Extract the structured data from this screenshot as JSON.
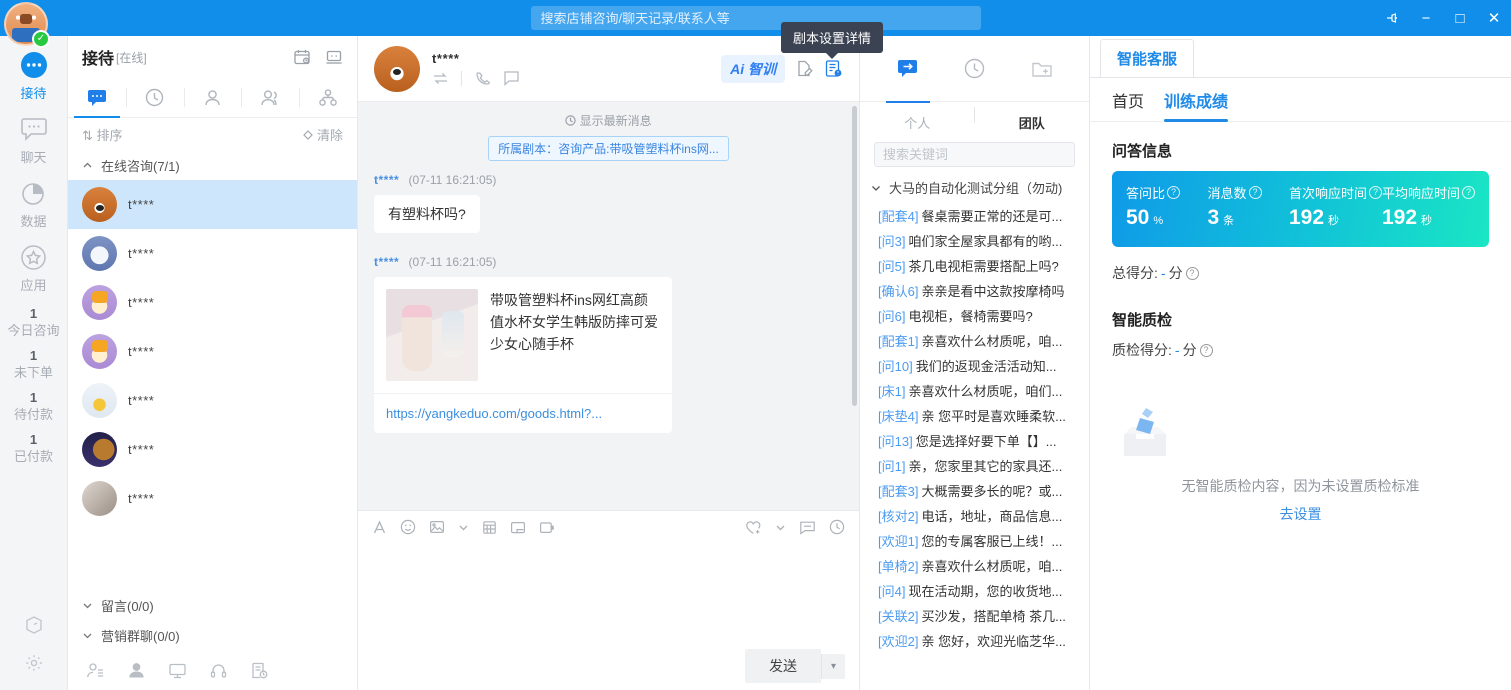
{
  "titlebar": {
    "search_placeholder": "搜索店铺咨询/聊天记录/联系人等",
    "pin_icon": "pin-icon",
    "minimize_label": "−",
    "maximize_label": "□",
    "close_label": "✕",
    "online_check": "✓"
  },
  "tooltip": {
    "text": "剧本设置详情"
  },
  "rail": {
    "items": [
      {
        "label": "接待",
        "icon": "reception-dots-icon",
        "active": true
      },
      {
        "label": "聊天",
        "icon": "chat-bubble-icon",
        "active": false
      },
      {
        "label": "数据",
        "icon": "pie-chart-icon",
        "active": false
      },
      {
        "label": "应用",
        "icon": "star-circle-icon",
        "active": false
      }
    ],
    "stats": [
      {
        "num": "1",
        "label": "今日咨询"
      },
      {
        "num": "1",
        "label": "未下单"
      },
      {
        "num": "1",
        "label": "待付款"
      },
      {
        "num": "1",
        "label": "已付款"
      }
    ],
    "bottom_icons": [
      "box-icon",
      "gear-icon"
    ]
  },
  "contacts": {
    "title": "接待",
    "status": "[在线]",
    "head_icons": [
      "calendar-settings-icon",
      "monitor-chat-icon"
    ],
    "tabs": [
      {
        "icon": "message-icon",
        "active": true
      },
      {
        "icon": "clock-icon",
        "active": false
      },
      {
        "icon": "person-icon",
        "active": false
      },
      {
        "icon": "people-icon",
        "active": false
      },
      {
        "icon": "org-tree-icon",
        "active": false
      }
    ],
    "sort_label": "排序",
    "clear_label": "清除",
    "group_label": "在线咨询(7/1)",
    "rows": [
      {
        "name": "t****",
        "avatar": "a-dog",
        "selected": true
      },
      {
        "name": "t****",
        "avatar": "a-bear",
        "selected": false
      },
      {
        "name": "t****",
        "avatar": "a-giraffe",
        "selected": false
      },
      {
        "name": "t****",
        "avatar": "a-giraffe",
        "selected": false
      },
      {
        "name": "t****",
        "avatar": "a-dress",
        "selected": false
      },
      {
        "name": "t****",
        "avatar": "a-bird",
        "selected": false
      },
      {
        "name": "t****",
        "avatar": "a-photo",
        "selected": false
      }
    ],
    "footer_groups": [
      {
        "label": "留言(0/0)"
      },
      {
        "label": "营销群聊(0/0)"
      }
    ],
    "footer_icons": [
      "contact-list-icon",
      "customer-icon",
      "monitor-icon",
      "headset-icon",
      "order-history-icon"
    ]
  },
  "chat": {
    "contact_name": "t****",
    "header_icons": [
      "transfer-icon",
      "phone-icon",
      "comment-icon"
    ],
    "ai_button": "Ai 智训",
    "right_icons": [
      "note-edit-icon",
      "script-detail-icon"
    ],
    "latest_label": "显示最新消息",
    "script_chip": "所属剧本：咨询产品:带吸管塑料杯ins网...",
    "messages": [
      {
        "sender": "t****",
        "time": "(07-11 16:21:05)",
        "type": "text",
        "text": "有塑料杯吗?"
      },
      {
        "sender": "t****",
        "time": "(07-11 16:21:05)",
        "type": "card",
        "card_title": "带吸管塑料杯ins网红高颜值水杯女学生韩版防摔可爱少女心随手杯",
        "card_link": "https://yangkeduo.com/goods.html?..."
      }
    ],
    "composer": {
      "left_icons": [
        "font-icon",
        "emoji-icon",
        "image-icon",
        "chevron-down-icon",
        "screenshot-icon",
        "folder-icon",
        "card-icon"
      ],
      "right_icons": [
        "favorite-icon",
        "chevron-down-icon",
        "quick-reply-icon",
        "history-icon"
      ],
      "text_value": "",
      "send_label": "发送",
      "send_caret": "▾"
    }
  },
  "scripts": {
    "tabs": [
      {
        "icon": "send-script-icon",
        "active": true
      },
      {
        "icon": "clock-icon",
        "active": false
      },
      {
        "icon": "folder-add-icon",
        "active": false
      }
    ],
    "segment": [
      {
        "label": "个人",
        "active": false
      },
      {
        "label": "团队",
        "active": true
      }
    ],
    "search_placeholder": "搜索关键词",
    "group_label": "大马的自动化测试分组（勿动)",
    "items": [
      {
        "tag": "[配套4]",
        "text": "餐桌需要正常的还是可..."
      },
      {
        "tag": "[问3]",
        "text": "咱们家全屋家具都有的哟..."
      },
      {
        "tag": "[问5]",
        "text": "茶几电视柜需要搭配上吗?"
      },
      {
        "tag": "[确认6]",
        "text": "亲亲是看中这款按摩椅吗"
      },
      {
        "tag": "[问6]",
        "text": "电视柜，餐椅需要吗?"
      },
      {
        "tag": "[配套1]",
        "text": "亲喜欢什么材质呢，咱..."
      },
      {
        "tag": "[问10]",
        "text": "我们的返现金活活动知..."
      },
      {
        "tag": "[床1]",
        "text": "亲喜欢什么材质呢，咱们..."
      },
      {
        "tag": "[床垫4]",
        "text": "亲 您平时是喜欢睡柔软..."
      },
      {
        "tag": "[问13]",
        "text": "您是选择好要下单【】..."
      },
      {
        "tag": "[问1]",
        "text": "亲，您家里其它的家具还..."
      },
      {
        "tag": "[配套3]",
        "text": "大概需要多长的呢？或..."
      },
      {
        "tag": "[核对2]",
        "text": "电话，地址，商品信息..."
      },
      {
        "tag": "[欢迎1]",
        "text": "您的专属客服已上线！..."
      },
      {
        "tag": "[单椅2]",
        "text": "亲喜欢什么材质呢，咱..."
      },
      {
        "tag": "[问4]",
        "text": "现在活动期，您的收货地..."
      },
      {
        "tag": "[关联2]",
        "text": "买沙发，搭配单椅 茶几..."
      },
      {
        "tag": "[欢迎2]",
        "text": "亲 您好，欢迎光临芝华..."
      }
    ]
  },
  "aipanel": {
    "tab_label": "智能客服",
    "subtabs": [
      {
        "label": "首页",
        "active": false
      },
      {
        "label": "训练成绩",
        "active": true
      }
    ],
    "qa_section_title": "问答信息",
    "metrics": [
      {
        "label": "答问比",
        "value": "50",
        "unit": "%"
      },
      {
        "label": "消息数",
        "value": "3",
        "unit": "条"
      },
      {
        "label": "首次响应时间",
        "value": "192",
        "unit": "秒"
      },
      {
        "label": "平均响应时间",
        "value": "192",
        "unit": "秒"
      }
    ],
    "total_score_label": "总得分:",
    "total_score_value": "-",
    "total_score_unit": "分",
    "qc_section_title": "智能质检",
    "qc_score_label": "质检得分:",
    "qc_score_value": "-",
    "qc_score_unit": "分",
    "empty_text": "无智能质检内容，因为未设置质检标准",
    "empty_link": "去设置",
    "empty_icon": "empty-box-icon"
  },
  "colors": {
    "brand": "#108ee9",
    "accent": "#1f8ae8",
    "metric_gradient_start": "#0f9ae8",
    "metric_gradient_end": "#1ae6c4",
    "selected_row": "#cde6fb",
    "online_green": "#26c940"
  }
}
